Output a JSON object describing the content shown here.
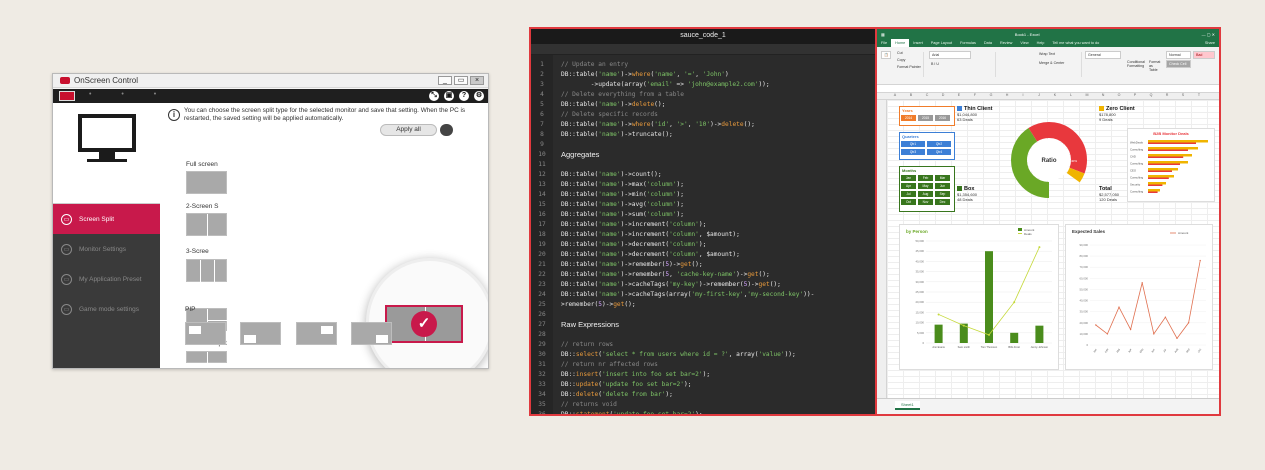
{
  "osc": {
    "title": "OnScreen Control",
    "win_min": "_",
    "win_max": "▭",
    "win_close": "×",
    "top_icons": [
      "⤡",
      "▣",
      "?",
      "⚙"
    ],
    "info": "You can choose the screen split type for the selected monitor and save that setting. When the PC is restarted, the saved setting will be applied automatically.",
    "apply_all": "Apply all",
    "nav": [
      {
        "label": "Screen Split",
        "active": true
      },
      {
        "label": "Monitor Settings",
        "active": false
      },
      {
        "label": "My Application Preset",
        "active": false
      },
      {
        "label": "Game mode settings",
        "active": false
      }
    ],
    "groups": {
      "full": "Full screen",
      "two": "2-Screen S",
      "three": "3-Scree",
      "four": "4-Screen Split",
      "pip": "PIP"
    },
    "selected_check": "✓"
  },
  "editor": {
    "title": "sauce_code_1",
    "lines": [
      {
        "n": "1",
        "kind": "c",
        "text": "// Update an entry"
      },
      {
        "n": "2",
        "kind": "code",
        "html": "DB::table(<span class='s'>'name'</span>)-><span class='k'>where</span>(<span class='s'>'name'</span>, <span class='s'>'='</span>, <span class='s'>'John'</span>)"
      },
      {
        "n": "3",
        "kind": "code",
        "html": "        ->update(array(<span class='s'>'email'</span> => <span class='s'>'john@example2.com'</span>));"
      },
      {
        "n": "4",
        "kind": "c",
        "text": "// Delete everything from a table"
      },
      {
        "n": "5",
        "kind": "code",
        "html": "DB::table(<span class='s'>'name'</span>)-><span class='k'>delete</span>();"
      },
      {
        "n": "6",
        "kind": "c",
        "text": "// Delete specific records"
      },
      {
        "n": "7",
        "kind": "code",
        "html": "DB::table(<span class='s'>'name'</span>)-><span class='k'>where</span>(<span class='s'>'id'</span>, <span class='s'>'>'</span>, <span class='s'>'10'</span>)-><span class='k'>delete</span>();"
      },
      {
        "n": "8",
        "kind": "code",
        "html": "DB::table(<span class='s'>'name'</span>)->truncate();"
      },
      {
        "n": "9",
        "kind": "blank",
        "text": ""
      },
      {
        "n": "10",
        "kind": "h",
        "text": "Aggregates"
      },
      {
        "n": "11",
        "kind": "blank",
        "text": ""
      },
      {
        "n": "12",
        "kind": "code",
        "html": "DB::table(<span class='s'>'name'</span>)->count();"
      },
      {
        "n": "13",
        "kind": "code",
        "html": "DB::table(<span class='s'>'name'</span>)->max(<span class='s'>'column'</span>);"
      },
      {
        "n": "14",
        "kind": "code",
        "html": "DB::table(<span class='s'>'name'</span>)->min(<span class='s'>'column'</span>);"
      },
      {
        "n": "15",
        "kind": "code",
        "html": "DB::table(<span class='s'>'name'</span>)->avg(<span class='s'>'column'</span>);"
      },
      {
        "n": "16",
        "kind": "code",
        "html": "DB::table(<span class='s'>'name'</span>)->sum(<span class='s'>'column'</span>);"
      },
      {
        "n": "17",
        "kind": "code",
        "html": "DB::table(<span class='s'>'name'</span>)->increment(<span class='s'>'column'</span>);"
      },
      {
        "n": "18",
        "kind": "code",
        "html": "DB::table(<span class='s'>'name'</span>)->increment(<span class='s'>'column'</span>, $amount);"
      },
      {
        "n": "19",
        "kind": "code",
        "html": "DB::table(<span class='s'>'name'</span>)->decrement(<span class='s'>'column'</span>);"
      },
      {
        "n": "20",
        "kind": "code",
        "html": "DB::table(<span class='s'>'name'</span>)->decrement(<span class='s'>'column'</span>, $amount);"
      },
      {
        "n": "21",
        "kind": "code",
        "html": "DB::table(<span class='s'>'name'</span>)->remember(<span class='v'>5</span>)-><span class='k'>get</span>();"
      },
      {
        "n": "22",
        "kind": "code",
        "html": "DB::table(<span class='s'>'name'</span>)->remember(<span class='v'>5</span>, <span class='s'>'cache-key-name'</span>)-><span class='k'>get</span>();"
      },
      {
        "n": "23",
        "kind": "code",
        "html": "DB::table(<span class='s'>'name'</span>)->cacheTags(<span class='s'>'my-key'</span>)->remember(<span class='v'>5</span>)-><span class='k'>get</span>();"
      },
      {
        "n": "24",
        "kind": "code",
        "html": "DB::table(<span class='s'>'name'</span>)->cacheTags(array(<span class='s'>'my-first-key'</span>,<span class='s'>'my-second-key'</span>))-"
      },
      {
        "n": "25",
        "kind": "code",
        "html": ">remember(<span class='v'>5</span>)-><span class='k'>get</span>();"
      },
      {
        "n": "26",
        "kind": "blank",
        "text": ""
      },
      {
        "n": "27",
        "kind": "h",
        "text": "Raw Expressions"
      },
      {
        "n": "28",
        "kind": "blank",
        "text": ""
      },
      {
        "n": "29",
        "kind": "c",
        "text": "// return rows"
      },
      {
        "n": "30",
        "kind": "code",
        "html": "DB::<span class='k'>select</span>(<span class='s'>'select * from users where id = ?'</span>, array(<span class='s'>'value'</span>));"
      },
      {
        "n": "31",
        "kind": "c",
        "text": "// return nr affected rows"
      },
      {
        "n": "32",
        "kind": "code",
        "html": "DB::<span class='k'>insert</span>(<span class='s'>'insert into foo set bar=2'</span>);"
      },
      {
        "n": "33",
        "kind": "code",
        "html": "DB::<span class='k'>update</span>(<span class='s'>'update foo set bar=2'</span>);"
      },
      {
        "n": "34",
        "kind": "code",
        "html": "DB::<span class='k'>delete</span>(<span class='s'>'delete from bar'</span>);"
      },
      {
        "n": "35",
        "kind": "c",
        "text": "// returns void"
      },
      {
        "n": "36",
        "kind": "code",
        "html": "DB::<span class='k'>statement</span>(<span class='s'>'update foo set bar=2'</span>);"
      },
      {
        "n": "37",
        "kind": "c",
        "text": "// raw expression inside a statement"
      }
    ]
  },
  "excel": {
    "window_title": "Book1 - Excel",
    "tell_me": "Tell me what you want to do",
    "share": "Share",
    "tabs": [
      "File",
      "Home",
      "Insert",
      "Page Layout",
      "Formulas",
      "Data",
      "Review",
      "View",
      "Help"
    ],
    "ribbon": {
      "cut": "Cut",
      "copy": "Copy",
      "format_painter": "Format Painter",
      "font": "Arial",
      "wrap_text": "Wrap Text",
      "merge_center": "Merge & Center",
      "number_format": "General",
      "conditional": "Conditional Formatting",
      "format_as_table": "Format as Table",
      "style_normal": "Normal",
      "style_bad": "Bad",
      "style_check": "Check Cell"
    },
    "columns": [
      "A",
      "B",
      "C",
      "D",
      "E",
      "F",
      "G",
      "H",
      "I",
      "J",
      "K",
      "L",
      "M",
      "N",
      "O",
      "P",
      "Q",
      "R",
      "S",
      "T"
    ],
    "sheet_tab": "Sheet1",
    "slicers": {
      "years": {
        "title": "Years",
        "items": [
          "2014",
          "2015",
          "2016"
        ]
      },
      "quarters": {
        "title": "Quarters",
        "items": [
          "Qtr1",
          "Qtr2",
          "Qtr3",
          "Qtr4"
        ]
      },
      "months": {
        "title": "Months",
        "items": [
          "Jan",
          "Feb",
          "Mar",
          "Apr",
          "May",
          "Jun",
          "Jul",
          "Aug",
          "Sep",
          "Oct",
          "Nov",
          "Dec"
        ]
      }
    },
    "kpis": [
      {
        "title": "Thin Client",
        "value": "$1,044,800",
        "deals": "63 Deals",
        "color": "#3c7fd6"
      },
      {
        "title": "Zero Client",
        "value": "$178,800",
        "deals": "9 Deals",
        "color": "#f0b400"
      },
      {
        "title": "Box",
        "value": "$1,354,600",
        "deals": "48 Deals",
        "color": "#38761d"
      },
      {
        "title": "Total",
        "value": "$2,577,050",
        "deals": "120 Deals",
        "color": "#111111"
      }
    ],
    "donut": {
      "center": "Ratio",
      "seg_labels": [
        "Box 41%",
        "Salt 40%",
        "Zero 4%"
      ]
    },
    "charts": {
      "b2b": {
        "title": "B2B Monitor Deals",
        "cats": [
          "WebDeals",
          "Consulting",
          "CAD",
          "Consulting",
          "CEO",
          "Consulting",
          "Security",
          "Consulting"
        ]
      },
      "person": {
        "title": "by Person",
        "legend_a": "Amount",
        "legend_b": "Deals",
        "cats": [
          "Ann Evans",
          "Sam smith",
          "Tom Thomson",
          "Billo Frost",
          "Jenny Johnson"
        ],
        "yticks": [
          "0",
          "5,000",
          "10,000",
          "15,000",
          "20,000",
          "25,000",
          "30,000",
          "35,000",
          "40,000",
          "45,000",
          "50,000"
        ]
      },
      "expected": {
        "title": "Expected Sales",
        "legend": "Amount",
        "yticks": [
          "0",
          "10,000",
          "20,000",
          "30,000",
          "40,000",
          "50,000",
          "60,000",
          "70,000",
          "80,000",
          "90,000"
        ],
        "cats": [
          "Jan",
          "Feb",
          "Mar",
          "Apr",
          "May",
          "Jun",
          "Jul",
          "Aug",
          "Sep",
          "Oct"
        ]
      }
    }
  },
  "chart_data": [
    {
      "type": "bar",
      "title": "by Person",
      "categories": [
        "Ann Evans",
        "Sam smith",
        "Tom Thomson",
        "Billo Frost",
        "Jenny Johnson"
      ],
      "series": [
        {
          "name": "Amount",
          "values": [
            9000,
            9500,
            45000,
            5000,
            8500
          ]
        },
        {
          "name": "Deals",
          "values": [
            14000,
            8500,
            4000,
            20000,
            47000
          ]
        }
      ],
      "ylim": [
        0,
        50000
      ]
    },
    {
      "type": "line",
      "title": "Expected Sales",
      "categories": [
        "Jan",
        "Feb",
        "Mar",
        "Apr",
        "May",
        "Jun",
        "Jul",
        "Aug",
        "Sep",
        "Oct"
      ],
      "series": [
        {
          "name": "Amount",
          "values": [
            18000,
            10000,
            34000,
            14000,
            56000,
            10000,
            25000,
            6000,
            20000,
            76000
          ]
        }
      ],
      "ylim": [
        0,
        90000
      ]
    },
    {
      "type": "pie",
      "title": "Ratio",
      "categories": [
        "Box",
        "Salt",
        "Zero"
      ],
      "values": [
        41,
        40,
        4
      ]
    }
  ]
}
